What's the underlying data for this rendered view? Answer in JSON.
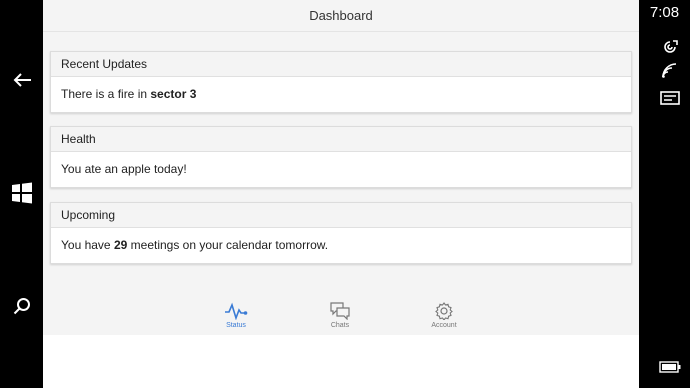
{
  "header": {
    "title": "Dashboard"
  },
  "status": {
    "time": "7:08"
  },
  "cards": [
    {
      "title": "Recent Updates",
      "text_before": "There is a fire in ",
      "text_bold": "sector 3",
      "text_after": ""
    },
    {
      "title": "Health",
      "text_before": "You ate an apple today!",
      "text_bold": "",
      "text_after": ""
    },
    {
      "title": "Upcoming",
      "text_before": "You have ",
      "text_bold": "29",
      "text_after": " meetings on your calendar tomorrow."
    }
  ],
  "tabs": [
    {
      "label": "Status",
      "icon": "pulse-icon",
      "active": true
    },
    {
      "label": "Chats",
      "icon": "chat-bubbles-icon",
      "active": false
    },
    {
      "label": "Account",
      "icon": "gear-icon",
      "active": false
    }
  ],
  "colors": {
    "accent": "#3a7bd5",
    "header_bg": "#f4f4f4"
  }
}
